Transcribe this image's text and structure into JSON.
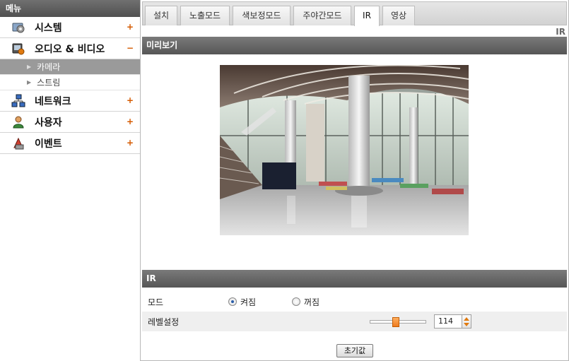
{
  "sidebar": {
    "header": "메뉴",
    "items": [
      {
        "label": "시스템",
        "toggle": "+",
        "icon": "gear-icon"
      },
      {
        "label": "오디오 & 비디오",
        "toggle": "−",
        "icon": "video-icon"
      },
      {
        "label": "네트워크",
        "toggle": "+",
        "icon": "network-icon"
      },
      {
        "label": "사용자",
        "toggle": "+",
        "icon": "user-icon"
      },
      {
        "label": "이벤트",
        "toggle": "+",
        "icon": "event-icon"
      }
    ],
    "submenu": [
      {
        "label": "카메라",
        "active": true
      },
      {
        "label": "스트림",
        "active": false
      }
    ]
  },
  "tabs": [
    {
      "label": "설치",
      "active": false
    },
    {
      "label": "노출모드",
      "active": false
    },
    {
      "label": "색보정모드",
      "active": false
    },
    {
      "label": "주야간모드",
      "active": false
    },
    {
      "label": "IR",
      "active": true
    },
    {
      "label": "영상",
      "active": false
    }
  ],
  "page": {
    "section_label": "IR",
    "preview_title": "미리보기",
    "ir_title": "IR"
  },
  "form": {
    "mode_label": "모드",
    "mode_options": [
      {
        "label": "켜짐",
        "checked": true
      },
      {
        "label": "꺼짐",
        "checked": false
      }
    ],
    "level_label": "레벨설정",
    "level_value": "114",
    "level_fraction": 0.45,
    "reset_label": "초기값"
  },
  "colors": {
    "accent_orange": "#ee7a1e",
    "header_gray": "#5a5a5a",
    "active_submenu": "#9a9a9a"
  }
}
